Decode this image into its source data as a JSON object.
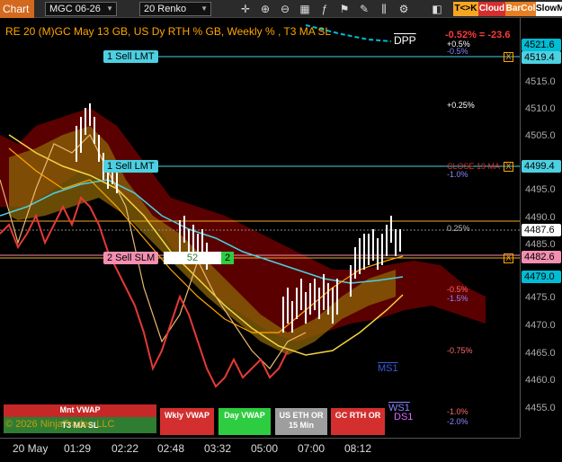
{
  "toolbar": {
    "chart_label": "Chart",
    "instrument": "MGC 06-26",
    "bar_type": "20 Renko",
    "btn_tk": "T<>K",
    "btn_cloud": "Cloud",
    "btn_barcol": "BarCol",
    "btn_slowm": "SlowM",
    "colors": {
      "tk": "#f5a623",
      "cloud": "#d32f2f",
      "barcol": "#e67e22",
      "slowm": "#ffffff"
    }
  },
  "chart": {
    "title": "RE 20  (M)GC May 13 GB, US Dy RTH % GB, Weekly % , T3 MA SL",
    "dpp_label": "DPP",
    "change_text": "-0.52% = -23.6",
    "copyright": "© 2026 NinjaTrader, LLC",
    "price_ticks": [
      "4515.0",
      "4510.0",
      "4505.0",
      "4495.0",
      "4490.0",
      "4485.0",
      "4475.0",
      "4470.0",
      "4465.0",
      "4460.0",
      "4455.0"
    ],
    "price_tags": [
      {
        "value": "4521.6",
        "color": "#00bcd4"
      },
      {
        "value": "4519.4",
        "color": "#4dd0e1"
      },
      {
        "value": "4499.4",
        "color": "#4dd0e1"
      },
      {
        "value": "4487.6",
        "color": "#ffffff"
      },
      {
        "value": "4482.6",
        "color": "#f48fb1"
      },
      {
        "value": "4479.0",
        "color": "#00bcd4"
      }
    ],
    "pct_labels": [
      "+0.5%",
      "-0.5%",
      "+0.25%",
      "CLOSE 19 MA",
      "-1.0%",
      "0.25%",
      "-0.5%",
      "-1.5%",
      "-0.75%",
      "-1.0%",
      "-2.0%"
    ],
    "level_labels": [
      "MS1",
      "WS1",
      "DS1"
    ],
    "orders": {
      "sell_lmt_1": "1 Sell LMT",
      "sell_lmt_2": "1 Sell LMT",
      "sell_slm": "2 Sell SLM",
      "slm_value": "52",
      "slm_qty": "2",
      "close_x": "X"
    },
    "time_labels": [
      "20 May",
      "01:29",
      "02:22",
      "02:48",
      "03:32",
      "05:00",
      "07:00",
      "08:12"
    ],
    "legend": [
      {
        "label": "Mnt VWAP",
        "color": "#c62828"
      },
      {
        "label": "T3 MA SL",
        "color": "#2e7d32"
      },
      {
        "label": "Wkly VWAP",
        "color": "#d32f2f"
      },
      {
        "label": "Day VWAP",
        "color": "#2ecc40"
      },
      {
        "label": "US ETH OR 15 Min",
        "color": "#9e9e9e"
      },
      {
        "label": "GC RTH OR",
        "color": "#d32f2f"
      }
    ],
    "colors": {
      "accent": "#ffa500",
      "cyan": "#4dd0e1",
      "cloud": "#8b0000",
      "band": "#b8860b"
    }
  }
}
